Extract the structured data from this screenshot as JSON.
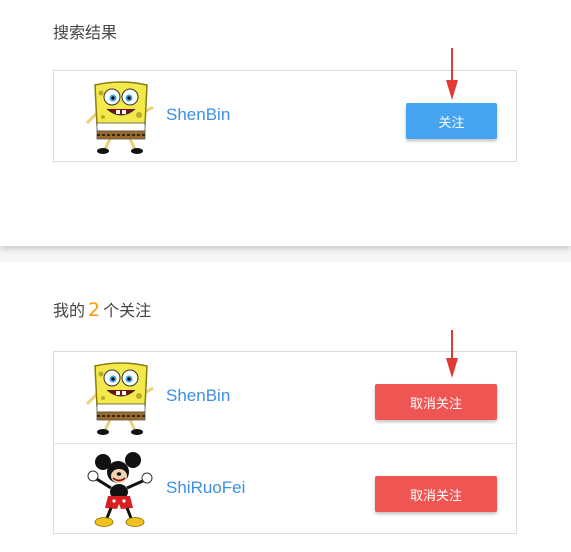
{
  "search": {
    "title": "搜索结果",
    "results": [
      {
        "username": "ShenBin",
        "avatar": "spongebob",
        "button_label": "关注"
      }
    ]
  },
  "following": {
    "title_prefix": "我的",
    "count": "2",
    "title_suffix": "个关注",
    "items": [
      {
        "username": "ShenBin",
        "avatar": "spongebob",
        "button_label": "取消关注"
      },
      {
        "username": "ShiRuoFei",
        "avatar": "mickey",
        "button_label": "取消关注"
      }
    ]
  },
  "colors": {
    "follow_button": "#45a3f0",
    "unfollow_button": "#ef5552",
    "username_link": "#3d8fe6",
    "count_highlight": "#ff9900",
    "annotation_arrow": "#e53935"
  }
}
